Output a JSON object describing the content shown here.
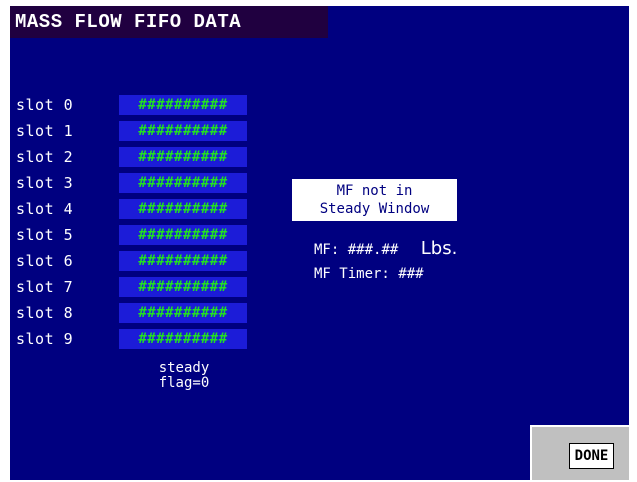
{
  "title": "MASS FLOW FIFO DATA",
  "slots": [
    {
      "label": "slot 0",
      "value": "##########"
    },
    {
      "label": "slot 1",
      "value": "##########"
    },
    {
      "label": "slot 2",
      "value": "##########"
    },
    {
      "label": "slot 3",
      "value": "##########"
    },
    {
      "label": "slot 4",
      "value": "##########"
    },
    {
      "label": "slot 5",
      "value": "##########"
    },
    {
      "label": "slot 6",
      "value": "##########"
    },
    {
      "label": "slot 7",
      "value": "##########"
    },
    {
      "label": "slot 8",
      "value": "##########"
    },
    {
      "label": "slot 9",
      "value": "##########"
    }
  ],
  "steady": {
    "line1": "steady",
    "line2": "flag=0"
  },
  "mf_status": {
    "line1": "MF not in",
    "line2": "Steady Window"
  },
  "mf": {
    "label": "MF:",
    "value": "###.##",
    "unit": "Lbs."
  },
  "mf_timer": {
    "label": "MF Timer:",
    "value": "###"
  },
  "done_label": "DONE",
  "colors": {
    "background": "#000080",
    "title_bar": "#200040",
    "slot_field": "#1c1cd8",
    "slot_text": "#22e022",
    "panel": "#c0c0c0"
  }
}
